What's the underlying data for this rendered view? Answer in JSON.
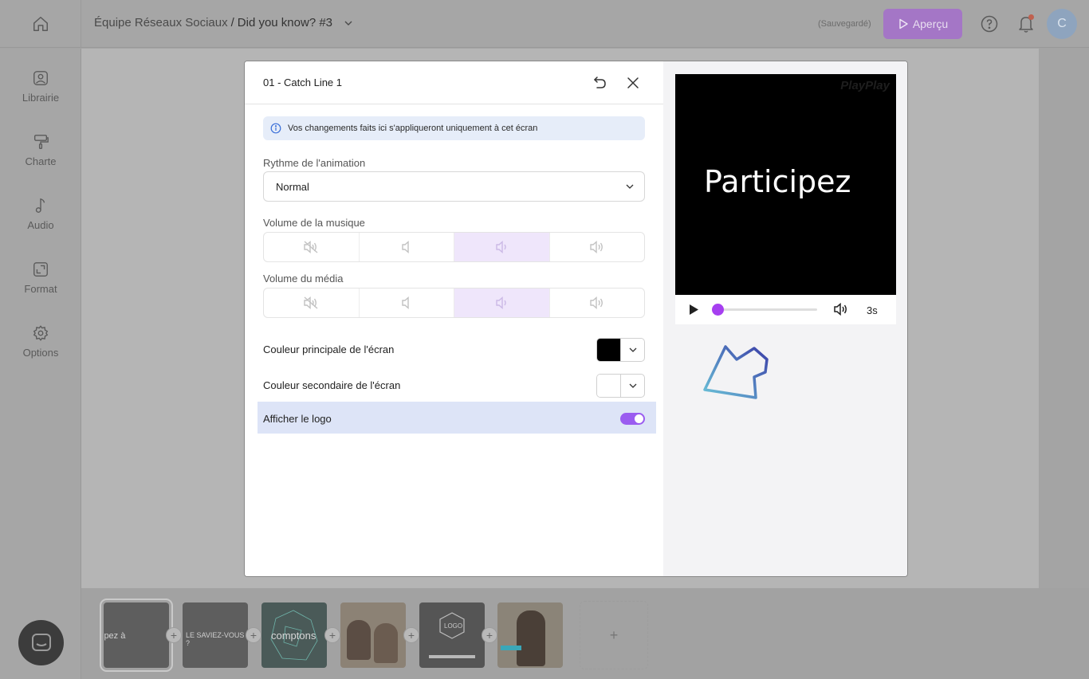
{
  "topbar": {
    "breadcrumb_team": "Équipe Réseaux Sociaux",
    "breadcrumb_sep": "/",
    "breadcrumb_project": "Did you know? #3",
    "saved_status": "(Sauvegardé)",
    "preview_label": "Aperçu",
    "avatar_initial": "C"
  },
  "sidebar": {
    "items": [
      {
        "label": "Librairie",
        "icon": "image-icon"
      },
      {
        "label": "Charte",
        "icon": "paint-roller-icon"
      },
      {
        "label": "Audio",
        "icon": "music-note-icon"
      },
      {
        "label": "Format",
        "icon": "format-icon"
      },
      {
        "label": "Options",
        "icon": "gear-icon"
      }
    ]
  },
  "modal": {
    "title": "01 - Catch Line 1",
    "info_text": "Vos changements faits ici s'appliqueront uniquement à cet écran",
    "rhythm_label": "Rythme de l'animation",
    "rhythm_value": "Normal",
    "music_volume_label": "Volume de la musique",
    "music_volume_level": 3,
    "media_volume_label": "Volume du média",
    "media_volume_level": 3,
    "primary_color_label": "Couleur principale de l'écran",
    "primary_color": "#000000",
    "secondary_color_label": "Couleur secondaire de l'écran",
    "secondary_color": "#ffffff",
    "logo_label": "Afficher le logo",
    "logo_enabled": true
  },
  "preview": {
    "watermark": "PlayPlay",
    "text": "Participez",
    "duration": "3s",
    "progress": 0
  },
  "timeline": {
    "thumbnails": [
      {
        "text": "ipez à"
      },
      {
        "text": "LE SAVIEZ-VOUS ?"
      },
      {
        "text": "comptons"
      },
      {
        "text": ""
      },
      {
        "text": "LOGO"
      },
      {
        "text": ""
      }
    ],
    "add_label": "+"
  },
  "colors": {
    "accent": "#9a5cf0",
    "preview_button": "#a476c6",
    "info_bg": "#e6edf9",
    "logo_row_bg": "#dde4f7"
  }
}
